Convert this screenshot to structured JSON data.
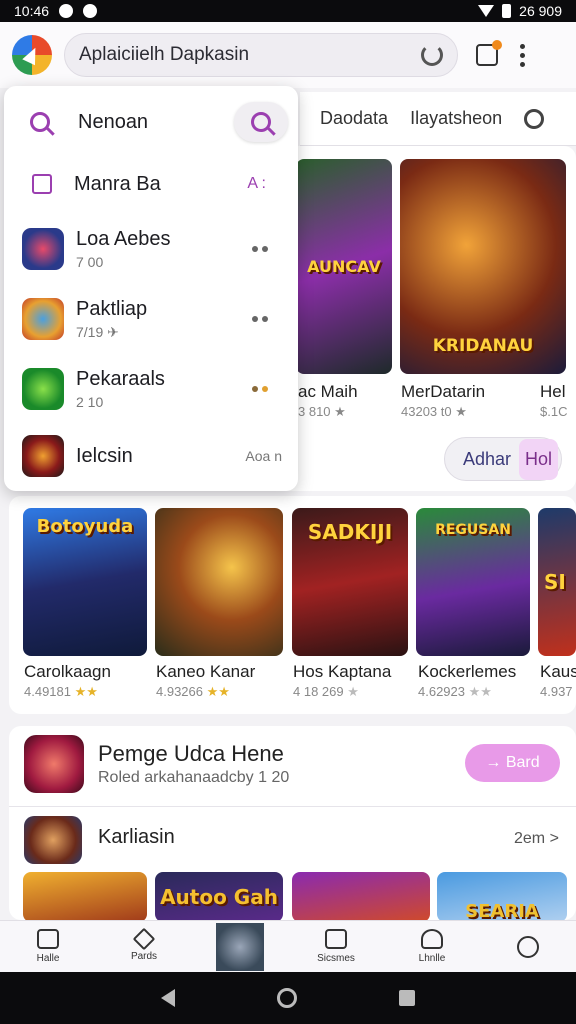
{
  "status": {
    "time": "10:46",
    "right": "26 909"
  },
  "appbar": {
    "search_text": "Aplaiciielh Dapkasin"
  },
  "tabs": [
    "Daodata",
    "Ilayatsheon"
  ],
  "dropdown": {
    "query": "Nenoan",
    "suggestion": {
      "label": "Manra Ba",
      "hint": "A :"
    },
    "items": [
      {
        "title": "Loa Aebes",
        "sub": "7 00"
      },
      {
        "title": "Paktliap",
        "sub": "7/19 ✈"
      },
      {
        "title": "Pekaraals",
        "sub": "2 10"
      },
      {
        "title": "Ielcsin",
        "sub": "Aoa n"
      }
    ]
  },
  "featured": {
    "tiles": [
      {
        "name": "ac Maih",
        "rating": "3 810 ★",
        "art": "AUNCAV"
      },
      {
        "name": "MerDatarin",
        "rating": "43203 t0 ★",
        "art": "KRIDANAU"
      },
      {
        "name": "Hel",
        "rating": "$.1C",
        "art": ""
      }
    ],
    "pill": {
      "left": "Adhar",
      "right": "Hol"
    }
  },
  "games": [
    {
      "name": "Carolkaagn",
      "rating": "4.49181",
      "art": "Botoyuda"
    },
    {
      "name": "Kaneo Kanar",
      "rating": "4.93266",
      "art": ""
    },
    {
      "name": "Hos Kaptana",
      "rating": "4 18 269",
      "art": "SADKIJI"
    },
    {
      "name": "Kockerlemes",
      "rating": "4.62923",
      "art": "REGUSAN"
    },
    {
      "name": "Kaus",
      "rating": "4.937",
      "art": "SI"
    }
  ],
  "promo": {
    "title": "Pemge Udca Hene",
    "subtitle": "Roled arkahanaadcby 1 20",
    "button": "→ Bard"
  },
  "section": {
    "title": "Karliasin",
    "link": "2em >"
  },
  "bottom_tiles": [
    "",
    "Autoo Gah",
    "",
    "SEARIA"
  ],
  "nav": [
    "Halle",
    "Pards",
    "",
    "Sicsmes",
    "Lhnlle",
    ""
  ],
  "colors": {
    "accent": "#9b3fb0",
    "pill": "#e89ae8"
  }
}
